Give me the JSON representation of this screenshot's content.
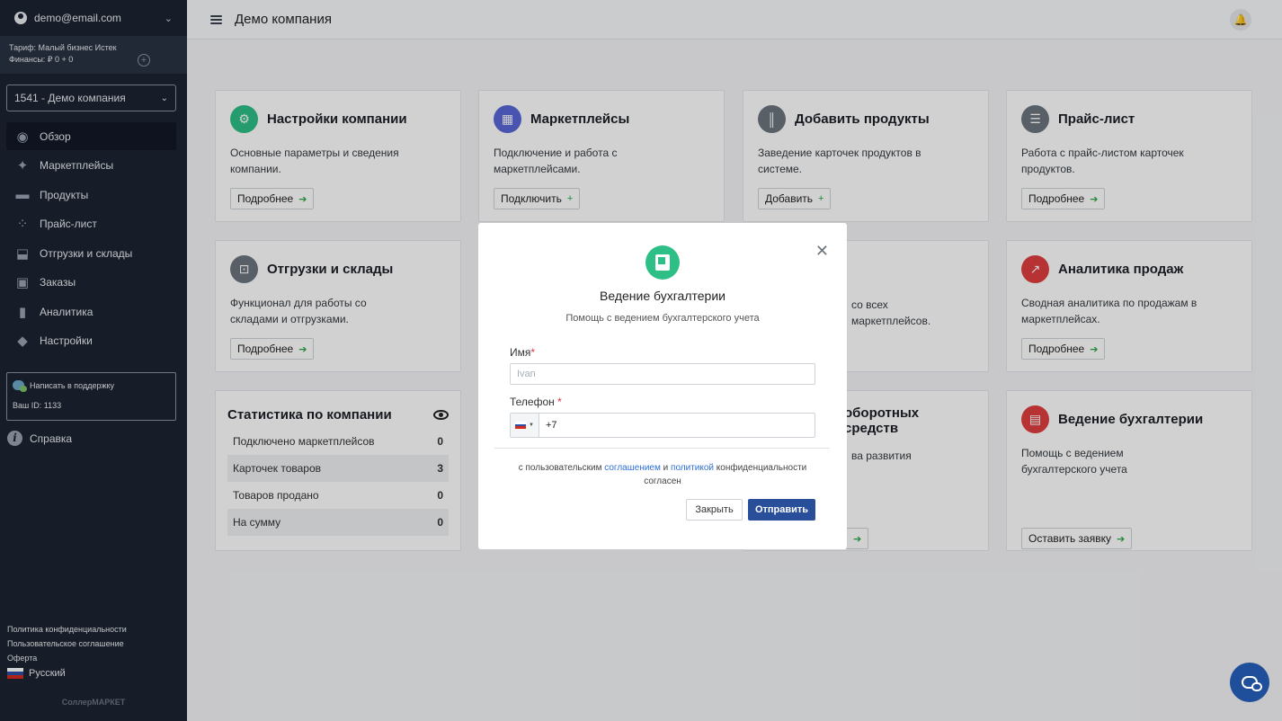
{
  "sidebar": {
    "user_email": "demo@email.com",
    "tariff_line": "Тариф: Малый бизнес Истек",
    "finance_line": "Финансы: ₽ 0 + 0",
    "company_select": "1541 - Демо компания",
    "nav": [
      {
        "label": "Обзор",
        "icon": "overview-icon",
        "active": true
      },
      {
        "label": "Маркетплейсы",
        "icon": "sparkle-icon"
      },
      {
        "label": "Продукты",
        "icon": "products-icon"
      },
      {
        "label": "Прайс-лист",
        "icon": "price-list-icon"
      },
      {
        "label": "Отгрузки и склады",
        "icon": "warehouse-icon"
      },
      {
        "label": "Заказы",
        "icon": "orders-icon"
      },
      {
        "label": "Аналитика",
        "icon": "analytics-icon"
      },
      {
        "label": "Настройки",
        "icon": "settings-icon"
      }
    ],
    "support_label": "Написать в поддержку",
    "support_id": "Ваш ID: 1133",
    "help_label": "Справка",
    "footer_links": [
      "Политика конфиденциальности",
      "Пользовательское соглашение",
      "Оферта"
    ],
    "language": "Русский",
    "brand": "СоллерМАРКЕТ"
  },
  "topbar": {
    "title": "Демо компания"
  },
  "cards": [
    {
      "title": "Настройки компании",
      "desc": "Основные параметры и сведения компании.",
      "button": "Подробнее",
      "arrow": "➔",
      "color": "#2dbf86"
    },
    {
      "title": "Маркетплейсы",
      "desc": "Подключение и работа с маркетплейсами.",
      "button": "Подключить",
      "arrow": "+",
      "color": "#5a67d8"
    },
    {
      "title": "Добавить продукты",
      "desc": "Заведение карточек продуктов в системе.",
      "button": "Добавить",
      "arrow": "+",
      "color": "#6c757d"
    },
    {
      "title": "Прайс-лист",
      "desc": "Работа с прайс-листом карточек продуктов.",
      "button": "Подробнее",
      "arrow": "➔",
      "color": "#6c757d"
    },
    {
      "title": "Отгрузки и склады",
      "desc": "Функционал для работы со складами и отгрузками.",
      "button": "Подробнее",
      "arrow": "➔",
      "color": "#6c757d"
    },
    {
      "title": "Аналитика продаж",
      "desc": "Сводная аналитика по продажам в маркетплейсах.",
      "button": "Подробнее",
      "arrow": "➔",
      "color": "#e03e3e"
    },
    {
      "title": "оборотных средств",
      "desc": "ва развития",
      "button": "",
      "arrow": "➔",
      "color": "#6c757d"
    },
    {
      "title": "Ведение бухгалтерии",
      "desc": "Помощь с ведением бухгалтерского учета",
      "button": "Оставить заявку",
      "arrow": "➔",
      "color": "#e03e3e"
    },
    {
      "title": "",
      "desc": "со всех маркетплейсов.",
      "button": "",
      "arrow": "",
      "color": "#6c757d"
    }
  ],
  "stats": {
    "title": "Статистика по компании",
    "rows": [
      {
        "label": "Подключено маркетплейсов",
        "value": "0"
      },
      {
        "label": "Карточек товаров",
        "value": "3"
      },
      {
        "label": "Товаров продано",
        "value": "0"
      },
      {
        "label": "На сумму",
        "value": "0"
      }
    ]
  },
  "modal": {
    "title": "Ведение бухгалтерии",
    "subtitle": "Помощь с ведением бухгалтерского учета",
    "name_label": "Имя",
    "name_placeholder": "Ivan",
    "phone_label": "Телефон",
    "required_mark": "*",
    "phone_value": "+7",
    "consent_prefix": "с пользовательским",
    "consent_link1": "соглашением",
    "consent_and": "и",
    "consent_link2": "политикой",
    "consent_suffix": "конфиденциальности согласен",
    "close_button": "Закрыть",
    "send_button": "Отправить"
  }
}
